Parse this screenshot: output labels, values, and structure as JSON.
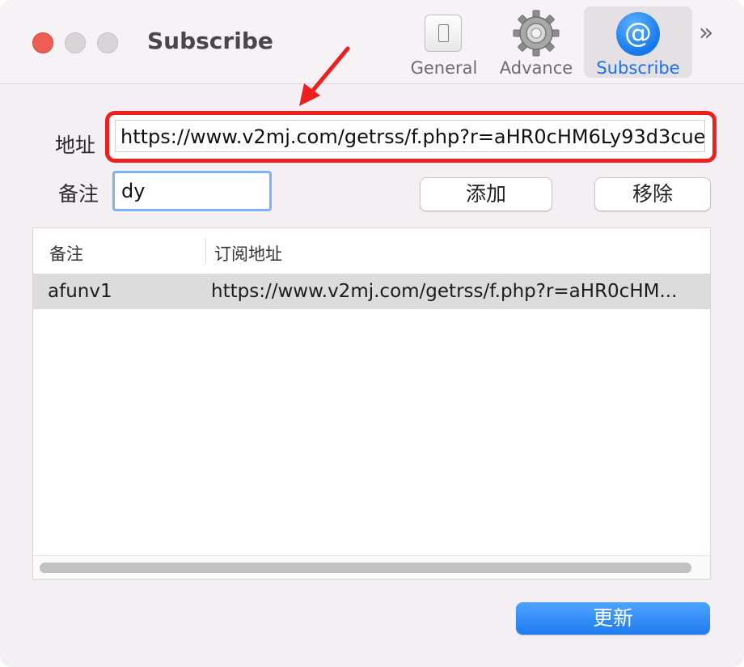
{
  "window": {
    "title": "Subscribe"
  },
  "toolbar": {
    "items": [
      {
        "label": "General",
        "icon": "switch-icon"
      },
      {
        "label": "Advance",
        "icon": "gear-icon"
      },
      {
        "label": "Subscribe",
        "icon": "at-sign-icon"
      }
    ],
    "overflow_glyph": "»",
    "subscribe_glyph": "@",
    "selected": "Subscribe"
  },
  "form": {
    "address_label": "地址",
    "address_value": "https://www.v2mj.com/getrss/f.php?r=aHR0cHM6Ly93d3cue",
    "note_label": "备注",
    "note_value": "dy",
    "add_label": "添加",
    "remove_label": "移除"
  },
  "table": {
    "columns": [
      "备注",
      "订阅地址"
    ],
    "rows": [
      {
        "note": "afunv1",
        "url": "https://www.v2mj.com/getrss/f.php?r=aHR0cHM..."
      }
    ]
  },
  "update_label": "更新",
  "colors": {
    "accent": "#1a72e6",
    "highlight": "#ee1f1f",
    "update_button": "#2a86f5",
    "close": "#ee5d55"
  }
}
